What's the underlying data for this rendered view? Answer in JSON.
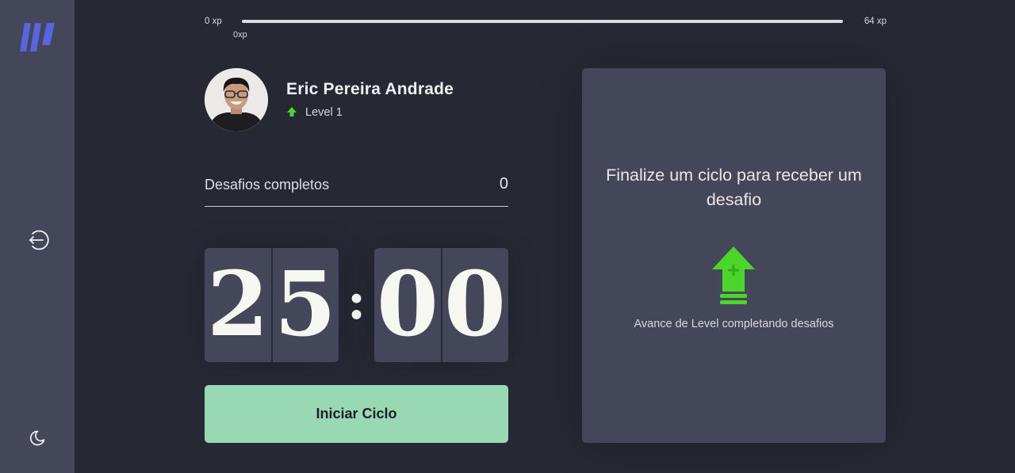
{
  "sidebar": {
    "logo_icon": "brand-logo-icon",
    "logout_icon": "logout-icon",
    "theme_icon": "moon-icon"
  },
  "xp_bar": {
    "min_label": "0 xp",
    "max_label": "64 xp",
    "current_label": "0xp",
    "progress": 0
  },
  "profile": {
    "name": "Eric Pereira Andrade",
    "level": "Level 1",
    "avatar_icon": "user-avatar"
  },
  "challenges": {
    "label": "Desafios completos",
    "count": "0"
  },
  "countdown": {
    "minute_left": "2",
    "minute_right": "5",
    "separator": ":",
    "second_left": "0",
    "second_right": "0"
  },
  "start_button": {
    "label": "Iniciar Ciclo"
  },
  "challenge_box": {
    "title": "Finalize um ciclo para receber um desafio",
    "hint": "Avance de Level completando desafios",
    "icon": "level-up-arrow-icon"
  },
  "colors": {
    "background": "#262834",
    "sidebar": "#444659",
    "accent_green": "#4cd62b",
    "button": "#98d8b3",
    "logo": "#5965e0"
  }
}
